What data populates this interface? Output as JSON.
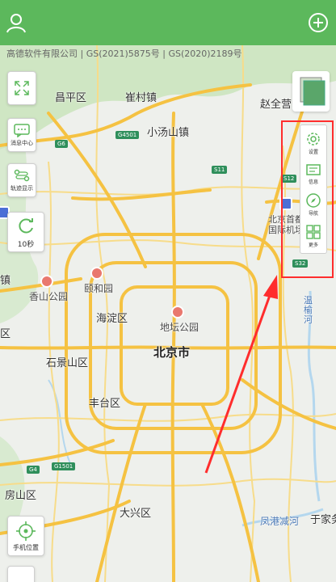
{
  "header": {
    "profile_icon": "user-icon",
    "add_icon": "plus-circle-icon",
    "bg_color": "#5cb85c"
  },
  "map": {
    "copyright": "高德软件有限公司 | GS(2021)5875号 | GS(2020)2189号",
    "places": {
      "changping": "昌平区",
      "cuicun": "崔村镇",
      "zhaoquanying": "赵全营",
      "xiaotangshan": "小汤山镇",
      "airport": "北京首都国际机场",
      "zhen": "镇",
      "xiangshan": "香山公园",
      "yiheyuan": "颐和园",
      "haidian": "海淀区",
      "ditan": "地坛公园",
      "beijing": "北京市",
      "qu": "区",
      "shijingshan": "石景山区",
      "fengtai": "丰台区",
      "fangshan": "房山区",
      "daxing": "大兴区",
      "fenggang": "凤港减河",
      "yujia": "于家务",
      "wenyu": "温榆河"
    },
    "shields": {
      "g6": "G6",
      "g4501": "G4501",
      "s11": "S11",
      "s12": "S12",
      "s32": "S32",
      "g4": "G4",
      "g1501": "G1501"
    }
  },
  "controls": {
    "zoom_icon": "expand-arrows-icon",
    "message_center": "消息中心",
    "track_display": "轨迹显示",
    "refresh_label": "10秒",
    "phone_location": "手机位置"
  },
  "toolbar": {
    "settings": "设置",
    "info": "信息",
    "navigation": "导航",
    "more": "更多"
  },
  "colors": {
    "highlight": "#ff2d2d",
    "road_major": "#f5c242",
    "road_minor": "#f7dc8a",
    "forest": "#cfe6c3",
    "water": "#b4d7ee"
  }
}
